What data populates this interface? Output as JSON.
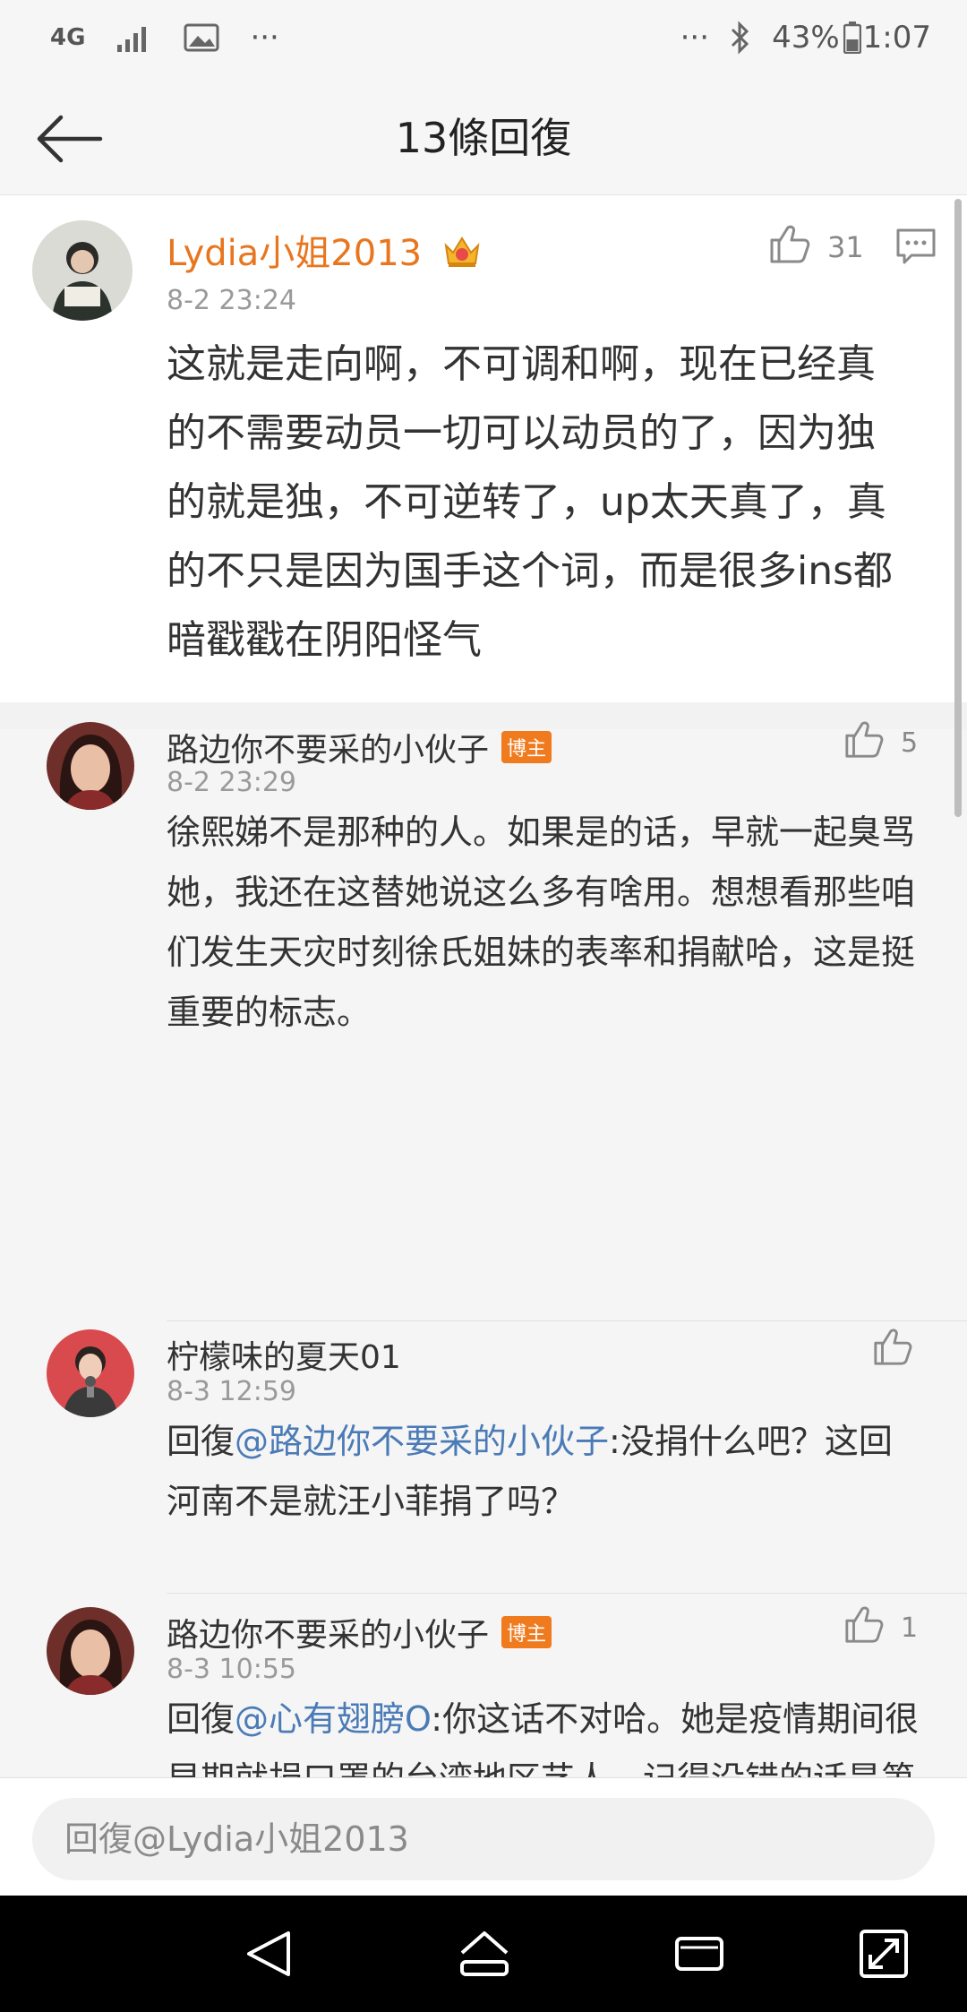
{
  "status_bar": {
    "network": "4G",
    "dots_left": "···",
    "dots_right": "···",
    "battery": "43%",
    "time": "1:07"
  },
  "header": {
    "title": "13條回復"
  },
  "top_comment": {
    "username": "Lydia小姐2013",
    "time": "8-2 23:24",
    "likes": "31",
    "text": "这就是走向啊，不可调和啊，现在已经真的不需要动员一切可以动员的了，因为独的就是独，不可逆转了，up太天真了，真的不只是因为国手这个词，而是很多ins都暗戳戳在阴阳怪气"
  },
  "replies": [
    {
      "username": "路边你不要采的小伙子",
      "badge": "博主",
      "time": "8-2 23:29",
      "likes": "5",
      "prefix": "",
      "mention": "",
      "text": "徐熙娣不是那种的人。如果是的话，早就一起臭骂她，我还在这替她说这么多有啥用。想想看那些咱们发生天灾时刻徐氏姐妹的表率和捐献哈，这是挺重要的标志。"
    },
    {
      "username": "柠檬味的夏天01",
      "badge": "",
      "time": "8-3 12:59",
      "likes": "",
      "prefix": "回復",
      "mention": "@路边你不要采的小伙子",
      "text": ":没捐什么吧？这回河南不是就汪小菲捐了吗？"
    },
    {
      "username": "路边你不要采的小伙子",
      "badge": "博主",
      "time": "8-3 10:55",
      "likes": "1",
      "prefix": "回復",
      "mention": "@心有翅膀O",
      "text": ":你这话不对哈。她是疫情期间很早期就捐口罩的台湾地区艺人，记得没错的话是第一批。说到口罩，现在咱们的供应链全面起来了，口罩咱们根本不是个事。但是去"
    }
  ],
  "reply_bar": {
    "placeholder": "回復@Lydia小姐2013"
  },
  "icons": {
    "back": "back-arrow-icon",
    "like": "thumbs-up-icon",
    "comment": "comment-icon",
    "crown": "crown-badge-icon",
    "nav_back": "nav-back-icon",
    "nav_home": "nav-home-icon",
    "nav_recents": "nav-recents-icon",
    "nav_expand": "nav-expand-icon"
  },
  "colors": {
    "vip_name": "#e8761e",
    "badge": "#f07a1e",
    "mention": "#4b7bb6"
  }
}
